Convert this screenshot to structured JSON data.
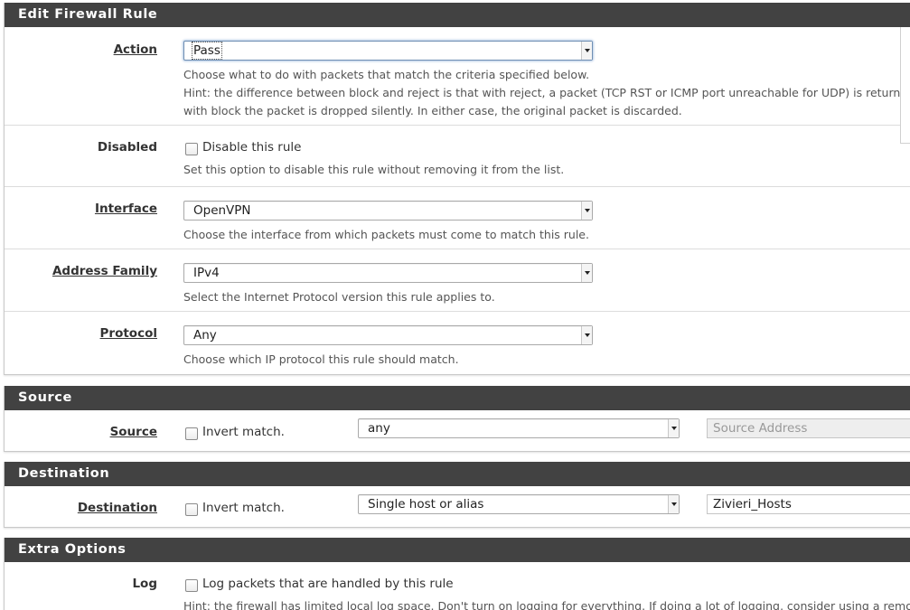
{
  "sections": {
    "edit_rule": {
      "title": "Edit Firewall Rule"
    },
    "source": {
      "title": "Source"
    },
    "destination": {
      "title": "Destination"
    },
    "extra": {
      "title": "Extra Options"
    }
  },
  "action": {
    "label": "Action",
    "value": "Pass",
    "help1": "Choose what to do with packets that match the criteria specified below.",
    "help2": "Hint: the difference between block and reject is that with reject, a packet (TCP RST or ICMP port unreachable for UDP) is returned to the sender, whereas",
    "help3": "with block the packet is dropped silently. In either case, the original packet is discarded."
  },
  "disabled": {
    "label": "Disabled",
    "checkbox_label": "Disable this rule",
    "help": "Set this option to disable this rule without removing it from the list."
  },
  "interface": {
    "label": "Interface",
    "value": "OpenVPN",
    "help": "Choose the interface from which packets must come to match this rule."
  },
  "address_family": {
    "label": "Address Family",
    "value": "IPv4",
    "help": "Select the Internet Protocol version this rule applies to."
  },
  "protocol": {
    "label": "Protocol",
    "value": "Any",
    "help": "Choose which IP protocol this rule should match."
  },
  "source": {
    "label": "Source",
    "invert_label": "Invert match.",
    "type_value": "any",
    "address_placeholder": "Source Address"
  },
  "destination": {
    "label": "Destination",
    "invert_label": "Invert match.",
    "type_value": "Single host or alias",
    "address_value": "Zivieri_Hosts"
  },
  "log": {
    "label": "Log",
    "checkbox_label": "Log packets that are handled by this rule",
    "help": "Hint: the firewall has limited local log space. Don't turn on logging for everything. If doing a lot of logging, consider using a remote syslog server"
  }
}
